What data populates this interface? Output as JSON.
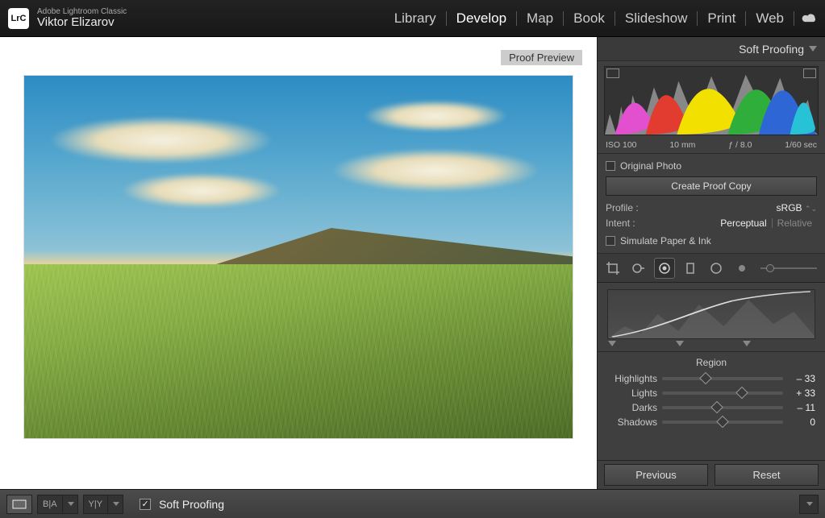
{
  "app": {
    "name": "Adobe Lightroom Classic",
    "logo": "LrC",
    "user": "Viktor Elizarov"
  },
  "modules": {
    "items": [
      "Library",
      "Develop",
      "Map",
      "Book",
      "Slideshow",
      "Print",
      "Web"
    ],
    "active": "Develop"
  },
  "canvas": {
    "proof_badge": "Proof Preview"
  },
  "panel": {
    "title": "Soft Proofing",
    "meta": {
      "iso": "ISO 100",
      "focal": "10 mm",
      "aperture": "ƒ / 8.0",
      "shutter": "1/60 sec"
    },
    "original_photo": "Original Photo",
    "create_proof": "Create Proof Copy",
    "profile": {
      "label": "Profile :",
      "value": "sRGB"
    },
    "intent": {
      "label": "Intent :",
      "opts": [
        "Perceptual",
        "Relative"
      ],
      "selected": "Perceptual"
    },
    "simulate": "Simulate Paper & Ink"
  },
  "region": {
    "heading": "Region",
    "rows": [
      {
        "label": "Highlights",
        "value": "– 33",
        "pos": 36
      },
      {
        "label": "Lights",
        "value": "+ 33",
        "pos": 66
      },
      {
        "label": "Darks",
        "value": "– 11",
        "pos": 45
      },
      {
        "label": "Shadows",
        "value": "0",
        "pos": 50
      }
    ]
  },
  "footer": {
    "previous": "Previous",
    "reset": "Reset"
  },
  "bottombar": {
    "soft_proof_label": "Soft Proofing",
    "soft_proof_checked": true
  }
}
